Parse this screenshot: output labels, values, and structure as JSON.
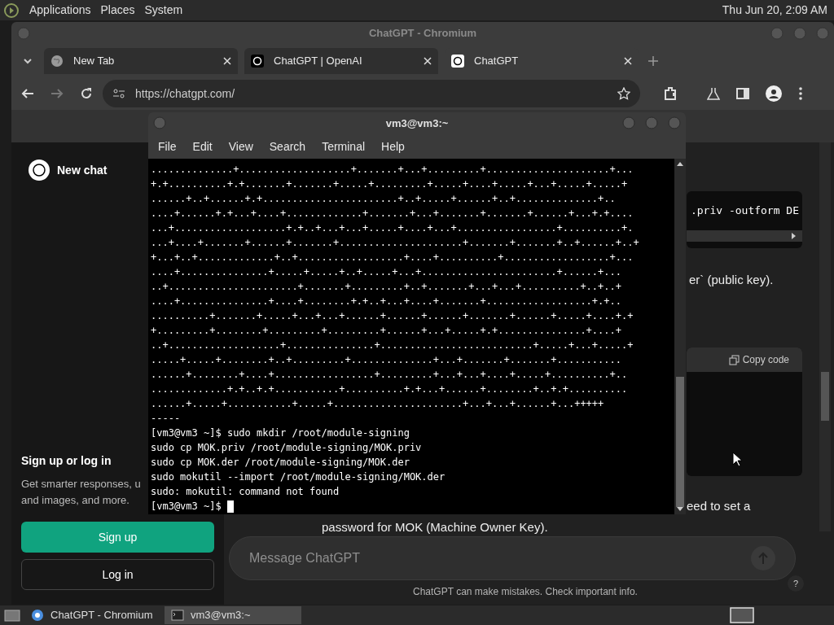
{
  "top_panel": {
    "menus": [
      "Applications",
      "Places",
      "System"
    ],
    "clock": "Thu Jun 20,  2:09 AM"
  },
  "browser": {
    "title": "ChatGPT - Chromium",
    "tabs": [
      {
        "label": "New Tab",
        "kind": "globe",
        "selected": false
      },
      {
        "label": "ChatGPT | OpenAI",
        "kind": "logo",
        "selected": false
      },
      {
        "label": "ChatGPT",
        "kind": "logo",
        "selected": true
      }
    ],
    "url": "https://chatgpt.com/",
    "sidebar": {
      "new_chat": "New chat",
      "signup_title": "Sign up or log in",
      "signup_text": [
        "Get smarter responses, u",
        "and images, and more."
      ],
      "buttons": [
        "Sign up",
        "Log in"
      ]
    },
    "chat": {
      "code_fragment": ".priv -outform DE",
      "text_1": "er` (public key).",
      "copy_code": "Copy code",
      "text_2": "eed to set a",
      "text_3": "password for MOK (Machine Owner Key).",
      "placeholder": "Message ChatGPT",
      "disclaimer": "ChatGPT can make mistakes. Check important info.",
      "help": "?"
    }
  },
  "terminal": {
    "title": "vm3@vm3:~",
    "menus": [
      "File",
      "Edit",
      "View",
      "Search",
      "Terminal",
      "Help"
    ],
    "lines": [
      "..............+...................+.......+...+.........+.....................+...",
      "+.+..........+.+.......+.......+.....+.........+.....+....+.....+...+.....+.....+",
      "......+..+......+.+.......................+..+.....+......+..+..............+..",
      "....+......+.+...+....+.............+.......+...+.......+.......+......+...+.+....",
      "...+...................+.+..+...+...+.....+....+...+.................+..........+.",
      "...+....+.......+......+.......+.....................+.......+.......+..+......+..+",
      "+...+..+.............+..+..................+....+..........+..................+...",
      "....+...............+.....+.....+..+.....+...+.......................+......+...",
      "..+......................+.......+.........+..+.......+...+...+..........+..+..+",
      "....+...............+....+........+.+..+...+....+.......+..................+.+..",
      "..........+.......+.....+...+...+......+......+......+.......+......+.....+....+.+",
      "+.........+........+.........+.........+......+...+.....+.+...............+....+",
      "..+...................+...............+..........................+.....+...+.....+",
      ".....+.....+........+..+.........+..............+...+.......+.......+...........",
      "......+........+....+.................+.........+...+...+....+.....+..........+..",
      ".............+.+..+.+...........+..........+.+...+......+........+..+.+..........",
      "......+.....+...........+.....+......................+...+...+......+...+++++",
      "-----",
      "[vm3@vm3 ~]$ sudo mkdir /root/module-signing",
      "sudo cp MOK.priv /root/module-signing/MOK.priv",
      "sudo cp MOK.der /root/module-signing/MOK.der",
      "sudo mokutil --import /root/module-signing/MOK.der",
      "sudo: mokutil: command not found",
      "[vm3@vm3 ~]$ "
    ]
  },
  "taskbar": {
    "items": [
      {
        "label": "ChatGPT - Chromium",
        "kind": "browser",
        "selected": false
      },
      {
        "label": "vm3@vm3:~",
        "kind": "terminal",
        "selected": true
      }
    ]
  }
}
